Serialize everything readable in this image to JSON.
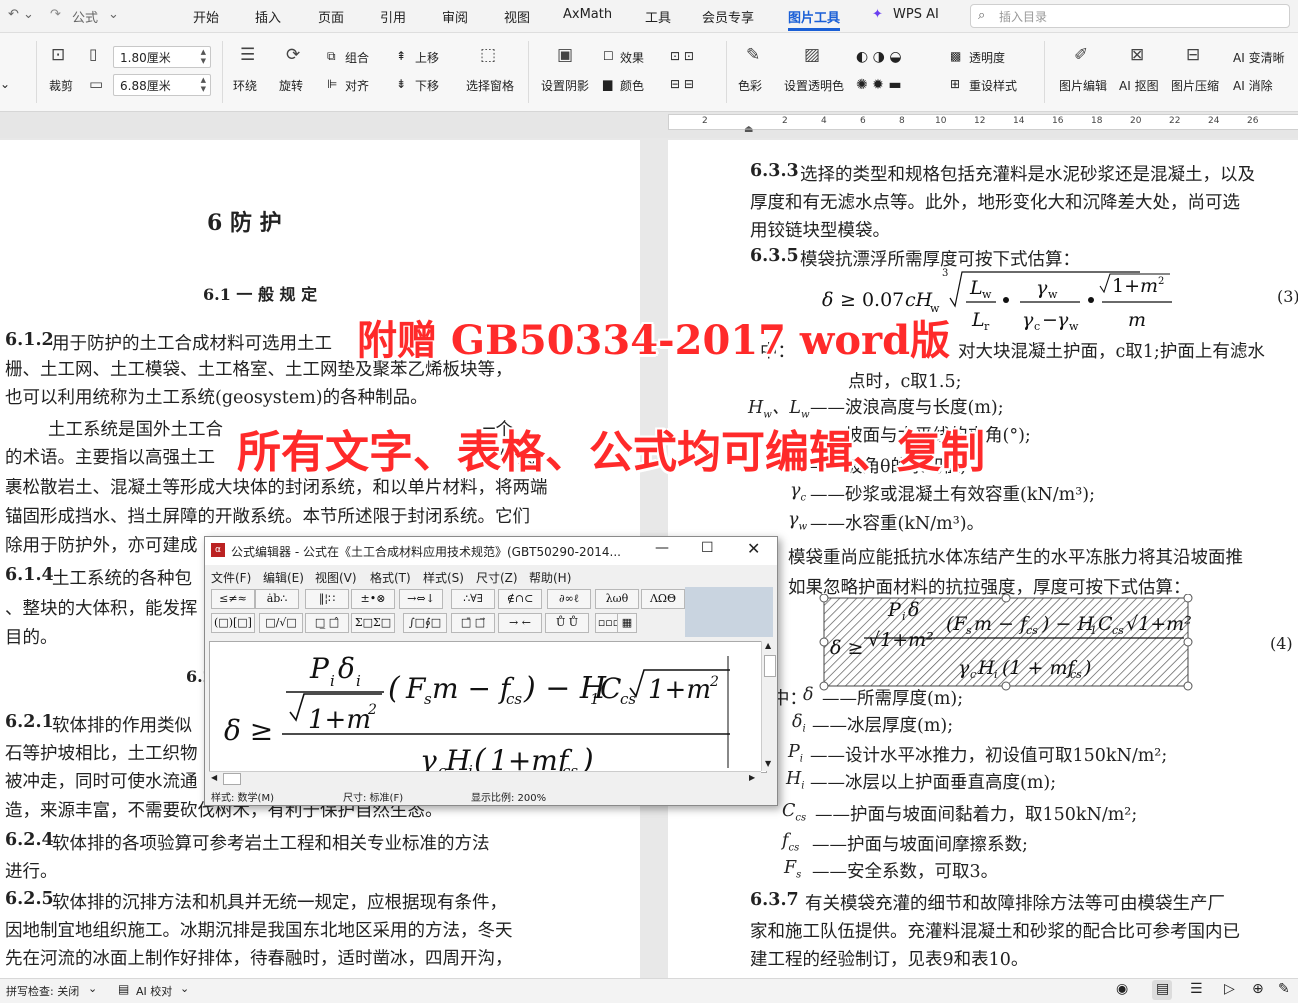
{
  "tabs": {
    "quick_label": "公式",
    "items": [
      "开始",
      "插入",
      "页面",
      "引用",
      "审阅",
      "视图",
      "AxMath",
      "工具",
      "会员专享",
      "图片工具",
      "WPS AI"
    ],
    "active_index": 9,
    "search_placeholder": "插入目录",
    "accent": "#1a5fd6"
  },
  "ribbon": {
    "crop": "裁剪",
    "width_value": "1.80厘米",
    "height_value": "6.88厘米",
    "wrap": "环绕",
    "rotate": "旋转",
    "group": "组合",
    "align": "对齐",
    "move_up": "上移",
    "move_down": "下移",
    "selection_pane": "选择窗格",
    "shadow": "设置阴影",
    "effects": "效果",
    "color": "颜色",
    "tint": "色彩",
    "transparent_color": "设置透明色",
    "transparency": "透明度",
    "reset_style": "重设样式",
    "pic_edit": "图片编辑",
    "ai_cutout": "AI 抠图",
    "pic_compress": "图片压缩",
    "ai_clear": "AI 变清晰",
    "ai_erase": "AI 消除"
  },
  "ruler": [
    "2",
    "2",
    "4",
    "6",
    "8",
    "10",
    "12",
    "14",
    "16",
    "18",
    "20",
    "22",
    "24",
    "26"
  ],
  "watermark": {
    "line1": "附赠 GB50334-2017 word版",
    "line2": "所有文字、表格、公式均可编辑、复制",
    "color": "#ff2a2a"
  },
  "left_page": {
    "chapter": "6  防      护",
    "section": "6.1  一  般  规  定",
    "p612_num": "6.1.2",
    "p612_l1": "用于防护的土工合成材料可选用土工",
    "p612_l2": "栅、土工网、土工模袋、土工格室、土工网垫及聚苯乙烯板块等，",
    "p612_l3": "也可以利用统称为土工系统(geosystem)的各种制品。",
    "p_geo_l1": "土工系统是国外土工合",
    "p_geo_l1b": "一个",
    "p_geo_l2a": "的术语。主要指以高强土工",
    "p_geo_l2b": "制成",
    "p_geo_l3": "裹松散岩土、混凝土等形成大块体的封闭系统，和以单片材料，将两端",
    "p_geo_l4": "锚固形成挡水、挡土屏障的开敞系统。本节所述限于封闭系统。它们",
    "p_geo_l5": "除用于防护外，亦可建成",
    "p614_num": "6.1.4",
    "p614_l1": "土工系统的各种包",
    "p614_l2": "、整块的大体积，能发挥",
    "p614_l3": "目的。",
    "sec62": "6.2",
    "p621_num": "6.2.1",
    "p621_l1": "软体排的作用类似",
    "p621_l2": "石等护坡相比，土工织物",
    "p621_l3": "被冲走，同时可使水流通",
    "p621_l4": "造，来源丰富，不需要砍伐树木，有利于保护自然生态。",
    "p624_num": "6.2.4",
    "p624_l1": "软体排的各项验算可参考岩土工程和相关专业标准的方法",
    "p624_l2": "进行。",
    "p625_num": "6.2.5",
    "p625_l1": "软体排的沉排方法和机具并无统一规定，应根据现有条件，",
    "p625_l2": "因地制宜地组织施工。冰期沉排是我国东北地区采用的方法，冬天",
    "p625_l3": "先在河流的冰面上制作好排体，待春融时，适时凿冰，四周开沟，"
  },
  "right_page": {
    "p633_num": "6.3.3",
    "p633_l1": "选择的类型和规格包括充灌料是水泥砂浆还是混凝土，以及",
    "p633_l2": "厚度和有无滤水点等。此外，地形变化大和沉降差大处，尚可选",
    "p633_l3": "用铰链块型模袋。",
    "p635_num": "6.3.5",
    "p635_l1": "模袋抗漂浮所需厚度可按下式估算：",
    "eq3_num": "(3)",
    "where_l1a": "中：",
    "where_l1b": "对大块混凝土护面，c取1;护面上有滤水",
    "where_l2": "点时，c取1.5;",
    "var_hw": "——波浪高度与长度(m);",
    "var_theta": "——坡面与水平线的夹角(°);",
    "var_m": "——坡角θ的余切值;",
    "var_gc": "——砂浆或混凝土有效容重(kN/m³);",
    "var_gw": "——水容重(kN/m³)。",
    "ice_l1": "模袋重尚应能抵抗水体冻结产生的水平冻胀力将其沿坡面推",
    "ice_l2": "如果忽略护面材料的抗拉强度，厚度可按下式估算：",
    "eq4_num": "(4)",
    "where2": "中：",
    "var_delta": "——所需厚度(m);",
    "var_deltai": "——冰层厚度(m);",
    "var_pi": "——设计水平冰推力，初设值可取150kN/m²;",
    "var_hi": "——冰层以上护面垂直高度(m);",
    "var_ccs": "——护面与坡面间黏着力，取150kN/m²;",
    "var_fcs": "——护面与坡面间摩擦系数;",
    "var_fs": "——安全系数，可取3。",
    "p637_num": "6.3.7",
    "p637_l1": "有关模袋充灌的细节和故障排除方法等可由模袋生产厂",
    "p637_l2": "家和施工队伍提供。充灌料混凝土和砂浆的配合比可参考国内已",
    "p637_l3": "建工程的经验制订，见表9和表10。"
  },
  "editor": {
    "title": "公式编辑器 - 公式在《土工合成材料应用技术规范》(GBT50290-2014...",
    "menus": [
      "文件(F)",
      "编辑(E)",
      "视图(V)",
      "格式(T)",
      "样式(S)",
      "尺寸(Z)",
      "帮助(H)"
    ],
    "toolbar_row1": [
      "≤≠≈",
      "ȧb∴",
      "‖¦∷",
      "±•⊗",
      "→⇔↓",
      "∴∀∃",
      "∉∩⊂",
      "∂∞ℓ",
      "λωθ",
      "ΛΩΘ"
    ],
    "toolbar_row2": [
      "(□)[□]",
      "□/√□",
      "□̲ □̂",
      "Σ□Σ□",
      "∫□∮□",
      "□̄ □⃗",
      "→ ←",
      "Ů Ů",
      "▫▫▫",
      "▦"
    ],
    "status_style": "样式: 数学(M)",
    "status_size": "尺寸: 标准(F)",
    "status_zoom": "显示比例: 200%"
  },
  "statusbar": {
    "spell": "拼写检查: 关闭",
    "proof": "AI 校对"
  }
}
